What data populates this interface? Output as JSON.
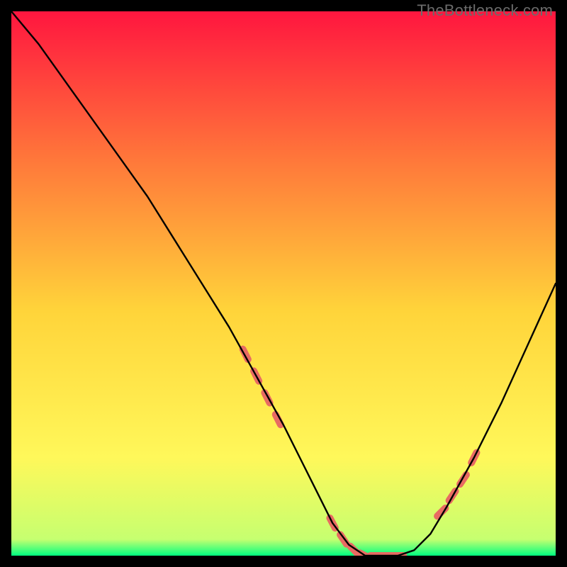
{
  "attribution": "TheBottleneck.com",
  "colors": {
    "background": "#000000",
    "gradient_top": "#ff163f",
    "gradient_mid_upper": "#ff7a3a",
    "gradient_mid": "#ffd43a",
    "gradient_lower": "#fff85a",
    "gradient_bottom": "#00ff80",
    "curve": "#000000",
    "marker": "#e86b62"
  },
  "chart_data": {
    "type": "line",
    "title": "",
    "xlabel": "",
    "ylabel": "",
    "xlim": [
      0,
      100
    ],
    "ylim": [
      0,
      100
    ],
    "series": [
      {
        "name": "bottleneck-curve",
        "x": [
          0,
          5,
          10,
          15,
          20,
          25,
          30,
          35,
          40,
          45,
          50,
          53,
          56,
          59,
          62,
          65,
          68,
          71,
          74,
          77,
          80,
          85,
          90,
          95,
          100
        ],
        "y": [
          100,
          94,
          87,
          80,
          73,
          66,
          58,
          50,
          42,
          33,
          24,
          18,
          12,
          6,
          2,
          0,
          0,
          0,
          1,
          4,
          9,
          18,
          28,
          39,
          50
        ]
      }
    ],
    "markers": {
      "name": "highlight-segments",
      "x": [
        43,
        45,
        47,
        49,
        59,
        61,
        63,
        65,
        67,
        69,
        71,
        79,
        81,
        83,
        85
      ],
      "y": [
        37,
        33,
        29,
        25,
        6,
        3,
        1,
        0,
        0,
        0,
        0,
        8,
        11,
        14,
        18
      ]
    }
  }
}
